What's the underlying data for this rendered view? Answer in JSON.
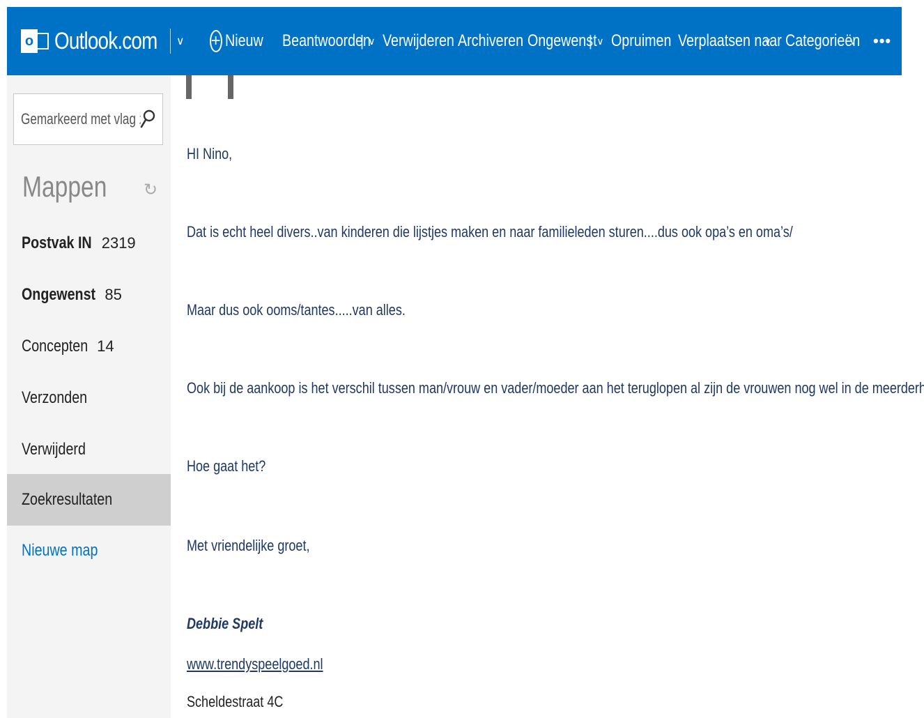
{
  "app": {
    "logo_letter": "o",
    "brand": "Outlook.com"
  },
  "toolbar": {
    "new_label": "Nieuw",
    "reply_label": "Beantwoorden",
    "delete_label": "Verwijderen",
    "archive_label": "Archiveren",
    "junk_label": "Ongewenst",
    "sweep_label": "Opruimen",
    "move_label": "Verplaatsen naar",
    "categories_label": "Categorieën",
    "more_label": "•••"
  },
  "sidebar": {
    "search_value": "Gemarkeerd met vlag zo",
    "folders_title": "Mappen",
    "folders": [
      {
        "label": "Postvak IN",
        "count": "2319"
      },
      {
        "label": "Ongewenst",
        "count": "85"
      },
      {
        "label": "Concepten",
        "count": "14"
      },
      {
        "label": "Verzonden",
        "count": ""
      },
      {
        "label": "Verwijderd",
        "count": ""
      },
      {
        "label": "Zoekresultaten",
        "count": ""
      }
    ],
    "new_folder_label": "Nieuwe map"
  },
  "message": {
    "greeting": "HI Nino,",
    "p1": "Dat is echt heel divers..van kinderen die lijstjes maken en naar familieleden sturen....dus ook opa’s en oma’s/",
    "p2": "Maar dus ook ooms/tantes.....van alles.",
    "p3": "Ook bij de aankoop is het verschil tussen man/vrouw en vader/moeder aan het teruglopen al zijn de vrouwen nog wel in de meerderheid.",
    "p4": "Hoe gaat het?",
    "closing": "Met vriendelijke groet,",
    "signature_name": "Debbie Spelt",
    "signature_url": "www.trendyspeelgoed.nl",
    "signature_address": "Scheldestraat 4C"
  },
  "colors": {
    "accent": "#0072c6",
    "body_text": "#1f3864",
    "sidebar_bg": "#f4f4f4",
    "active_folder_bg": "#cfcfcf"
  }
}
